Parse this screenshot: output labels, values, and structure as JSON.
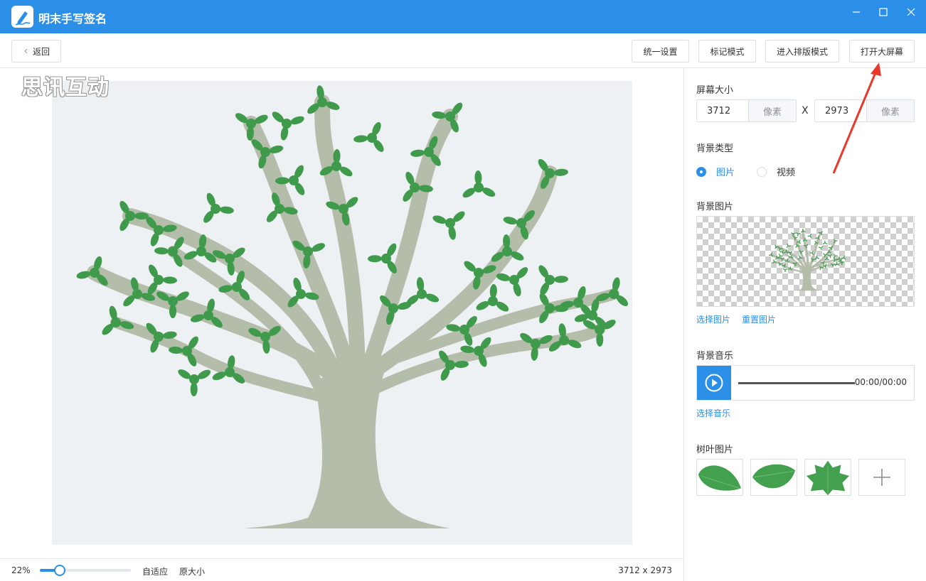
{
  "window": {
    "title": "明末手写签名"
  },
  "toolbar": {
    "back_label": "返回",
    "buttons": [
      "统一设置",
      "标记模式",
      "进入排版模式",
      "打开大屏幕"
    ]
  },
  "canvas": {
    "watermark": "思讯互动"
  },
  "status": {
    "zoom": "22%",
    "zoom_level": 0.22,
    "fit_label": "自适应",
    "original_label": "原大小",
    "size": "3712 x 2973"
  },
  "panel": {
    "screen_size_label": "屏幕大小",
    "width_value": "3712",
    "height_value": "2973",
    "unit": "像素",
    "x_sep": "X",
    "bg_type_label": "背景类型",
    "bg_type_options": [
      "图片",
      "视频"
    ],
    "bg_type_selected": "图片",
    "bg_image_label": "背景图片",
    "select_image": "选择图片",
    "reset_image": "重置图片",
    "bg_music_label": "背景音乐",
    "time": "00:00/00:00",
    "select_music": "选择音乐",
    "leaf_label": "树叶图片"
  },
  "colors": {
    "accent": "#2b8fe8",
    "trunk": "#b4bcaa",
    "leaf": "#3f9a4c",
    "annotation": "#e8382b"
  },
  "icons": {
    "app": "pen-icon",
    "back": "chevron-left-icon",
    "minimize": "minimize-icon",
    "maximize": "maximize-icon",
    "close": "close-icon",
    "play": "play-icon",
    "add": "plus-icon"
  }
}
